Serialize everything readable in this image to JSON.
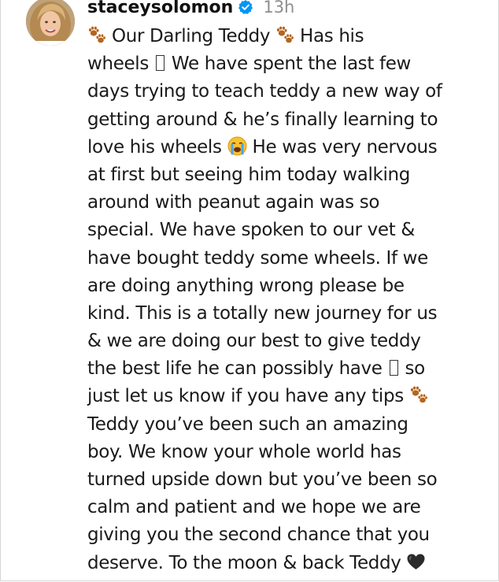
{
  "post": {
    "username": "staceysolomon",
    "time": "13h",
    "icons": {
      "avatar": "profile-photo",
      "verified": "verified-badge-icon",
      "paw": "paw-prints-emoji",
      "crying": "loudly-crying-face-emoji",
      "heart": "black-heart-emoji",
      "missing": "missing-glyph-box"
    },
    "colors": {
      "verified": "#0095f6",
      "time": "#8e8e8e",
      "paw": "#b5651d"
    },
    "caption": {
      "l1_a": "Our Darling Teddy",
      "l1_b": "Has his",
      "l2_a": "wheels",
      "l2_b": "We have spent the last few",
      "l3": "days trying to teach teddy a new way of",
      "l4": "getting around & he’s finally learning to",
      "l5_a": "love his wheels",
      "l5_b": "He was very nervous",
      "l6": "at first but seeing him today walking",
      "l7": "around with peanut again was so",
      "l8": "special. We have spoken to our vet &",
      "l9": "have bought teddy some wheels. If we",
      "l10": "are doing anything wrong please be",
      "l11": "kind. This is a totally new journey for us",
      "l12": "& we are doing our best to give teddy",
      "l13_a": "the best life he can possibly have",
      "l13_b": "so",
      "l14": "just let us know if you have any tips",
      "l15": "Teddy you’ve been such an amazing",
      "l16": "boy. We know your whole world has",
      "l17": "turned upside down but you’ve been so",
      "l18": "calm and patient and we hope we are",
      "l19": "giving you the second chance that you",
      "l20": "deserve. To the moon & back Teddy"
    }
  }
}
